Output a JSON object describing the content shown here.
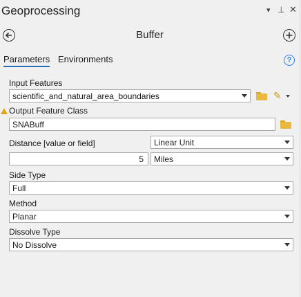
{
  "pane": {
    "title": "Geoprocessing",
    "pin_icon": "pin-icon",
    "menu_icon": "dropdown-arrow-icon",
    "close_icon": "close-icon"
  },
  "tool": {
    "title": "Buffer",
    "back_icon": "back-arrow-icon",
    "add_icon": "add-icon"
  },
  "tabs": [
    {
      "label": "Parameters",
      "active": true
    },
    {
      "label": "Environments",
      "active": false
    }
  ],
  "help": {
    "glyph": "?"
  },
  "params": {
    "input_features": {
      "label": "Input Features",
      "value": "scientific_and_natural_area_boundaries"
    },
    "output_feature_class": {
      "label": "Output Feature Class",
      "value": "SNABuff"
    },
    "distance": {
      "label": "Distance [value or field]",
      "type_value": "Linear Unit",
      "value": "5",
      "unit": "Miles"
    },
    "side_type": {
      "label": "Side Type",
      "value": "Full"
    },
    "method": {
      "label": "Method",
      "value": "Planar"
    },
    "dissolve_type": {
      "label": "Dissolve Type",
      "value": "No Dissolve"
    }
  },
  "colors": {
    "accent": "#2a6ebb",
    "warning": "#e8a21a",
    "folder": "#e9b840",
    "background": "#f0f0f0"
  }
}
